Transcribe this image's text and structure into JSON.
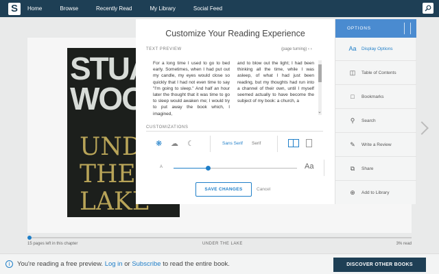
{
  "nav": {
    "logo": "S",
    "items": [
      "Home",
      "Browse",
      "Recently Read",
      "My Library",
      "Social Feed"
    ]
  },
  "book": {
    "cover_author": "STUART WOODS",
    "cover_title": "UNDER THE LAKE",
    "pages_left": "15 pages left in this chapter",
    "chapter": "UNDER THE LAKE",
    "percent_read": "3% read",
    "progress_fraction": 0.005
  },
  "preview": {
    "prefix": "You're reading a free preview.",
    "login": "Log in",
    "middle": "or",
    "subscribe": "Subscribe",
    "suffix": "to read the entire book.",
    "discover_button": "DISCOVER OTHER BOOKS"
  },
  "modal": {
    "title": "Customize Your Reading Experience",
    "text_preview_label": "TEXT PREVIEW",
    "page_turning_label": "(page turning)",
    "preview_col1": "For a long time I used to go to bed early. Sometimes, when I had put out my candle, my eyes would close so quickly that I had not even time to say \"I'm going to sleep.\" And half an hour later the thought that it was time to go to sleep would awaken me; I would try to put away the book which, I imagined,",
    "preview_col2": "and to blow out the light; I had been thinking all the time, while I was asleep, of what I had just been reading, but my thoughts had run into a channel of their own, until I myself seemed actually to have become the subject of my book: a church, a",
    "customizations_label": "CUSTOMIZATIONS",
    "font_sans": "Sans Serif",
    "font_serif": "Serif",
    "size_small": "A",
    "size_large": "Aa",
    "text_size_fraction": 0.27,
    "save_button": "SAVE CHANGES",
    "cancel_button": "Cancel"
  },
  "options": {
    "header": "OPTIONS",
    "items": [
      "Display Options",
      "Table of Contents",
      "Bookmarks",
      "Search",
      "Write a Review",
      "Share",
      "Add to Library"
    ]
  },
  "colors": {
    "nav_bg": "#1e3f55",
    "accent": "#1e7ec8",
    "options_header": "#4a8bd0"
  }
}
